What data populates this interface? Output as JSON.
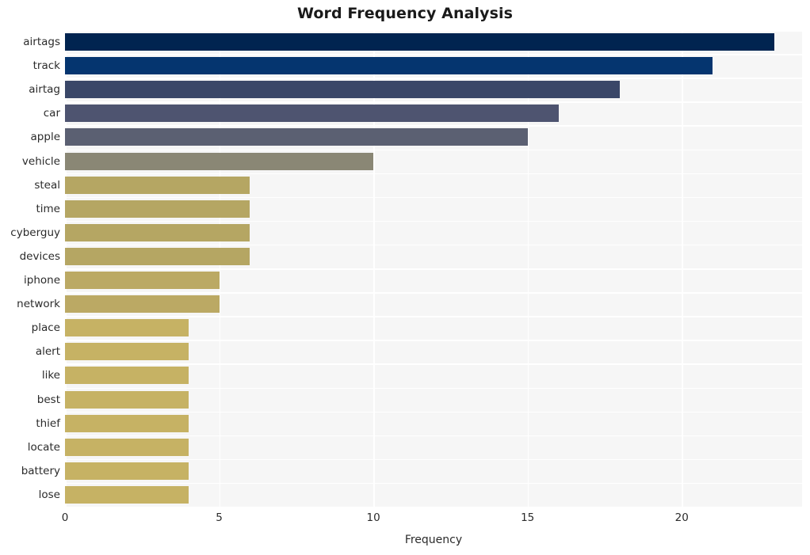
{
  "chart_data": {
    "type": "bar",
    "orientation": "horizontal",
    "title": "Word Frequency Analysis",
    "xlabel": "Frequency",
    "ylabel": "",
    "xlim": [
      0,
      23.9
    ],
    "xticks": [
      0,
      5,
      10,
      15,
      20
    ],
    "xtick_labels": [
      "0",
      "5",
      "10",
      "15",
      "20"
    ],
    "grid": true,
    "legend": null,
    "categories": [
      "airtags",
      "track",
      "airtag",
      "car",
      "apple",
      "vehicle",
      "steal",
      "time",
      "cyberguy",
      "devices",
      "iphone",
      "network",
      "place",
      "alert",
      "like",
      "best",
      "thief",
      "locate",
      "battery",
      "lose"
    ],
    "values": [
      23,
      21,
      18,
      16,
      15,
      10,
      6,
      6,
      6,
      6,
      5,
      5,
      4,
      4,
      4,
      4,
      4,
      4,
      4,
      4
    ],
    "bar_colors": [
      "#012450",
      "#05356f",
      "#3a4768",
      "#4e5470",
      "#5b6072",
      "#8a8775",
      "#b5a663",
      "#b5a663",
      "#b5a663",
      "#b5a663",
      "#bba964",
      "#bba964",
      "#c6b264",
      "#c6b264",
      "#c6b264",
      "#c6b264",
      "#c6b264",
      "#c6b264",
      "#c6b264",
      "#c6b264"
    ],
    "plot_background": "#f6f6f6",
    "grid_color": "#ffffff",
    "figure_background": "#ffffff"
  }
}
